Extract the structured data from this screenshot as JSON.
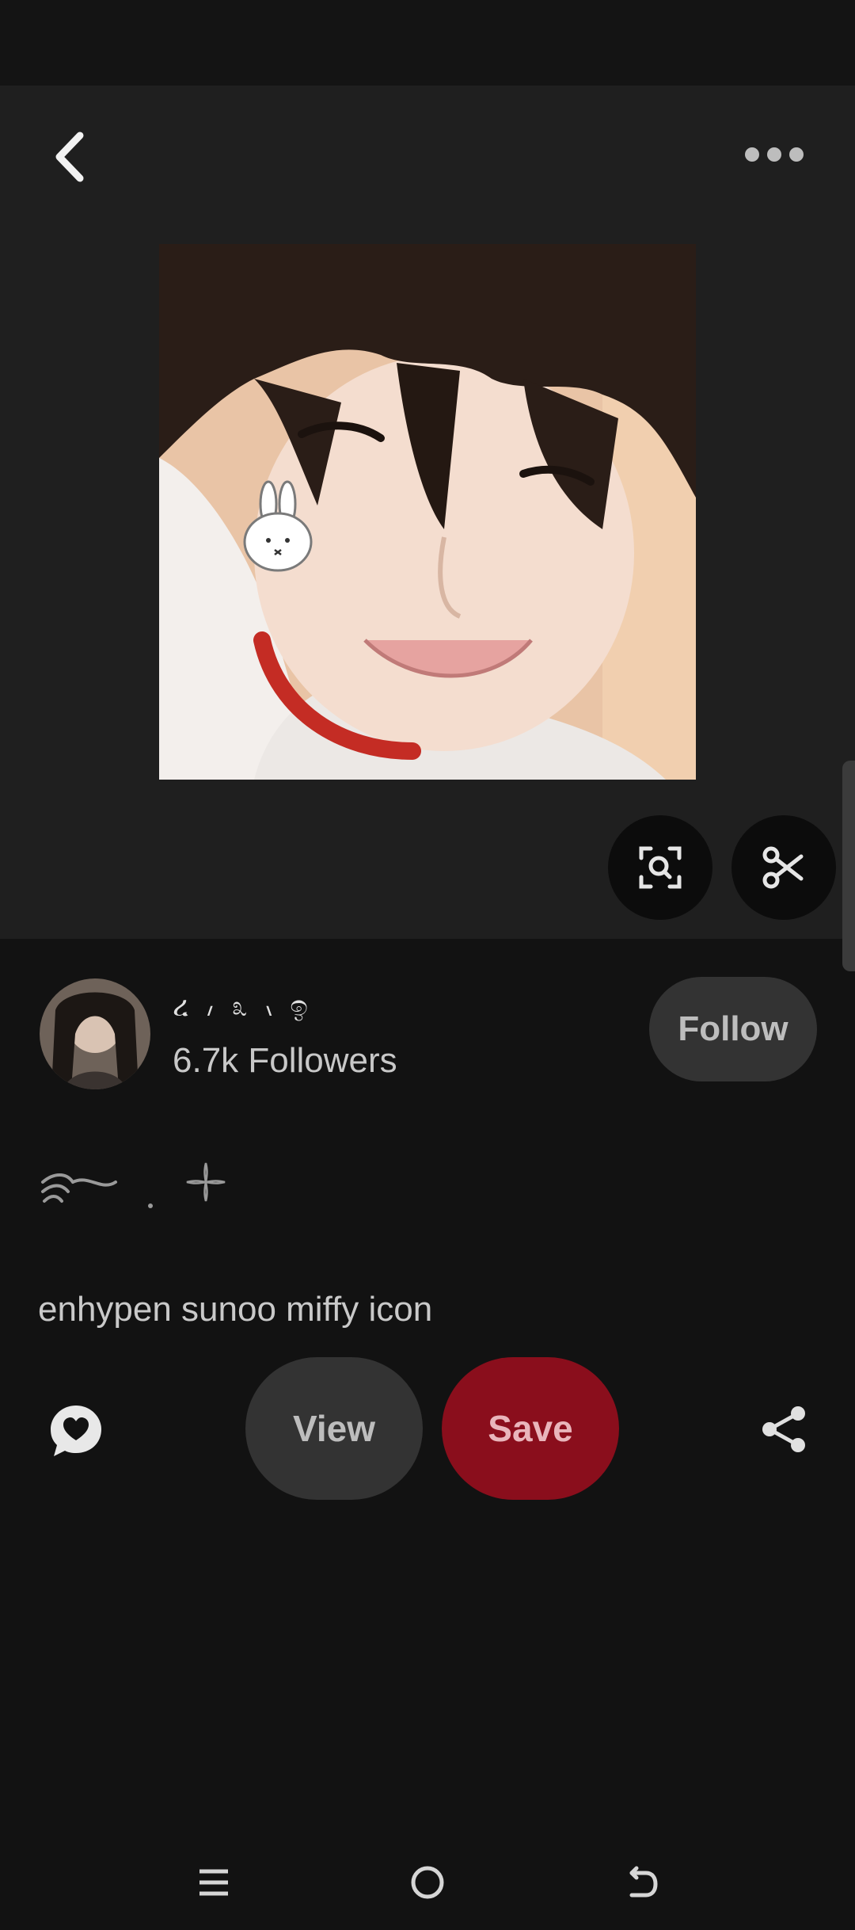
{
  "header": {
    "back_icon": "chevron-left-icon",
    "more_icon": "more-horizontal-icon"
  },
  "pin": {
    "image_icon": "photo-sunoo-miffy",
    "tools": [
      "visual-search-icon",
      "scissors-icon"
    ]
  },
  "creator": {
    "name": "ረ ៸ ೩ ៶ ඉ",
    "followers": "6.7k Followers",
    "follow_label": "Follow"
  },
  "pin_title": "enhypen sunoo miffy icon",
  "actions": {
    "comment_icon": "comment-heart-icon",
    "view_label": "View",
    "save_label": "Save",
    "share_icon": "share-icon"
  },
  "system_nav": [
    "recents-icon",
    "home-icon",
    "back-icon"
  ],
  "colors": {
    "background": "#121212",
    "panel": "#1f1f1f",
    "save_red": "#8a0e1c",
    "button_gray": "#333333"
  }
}
